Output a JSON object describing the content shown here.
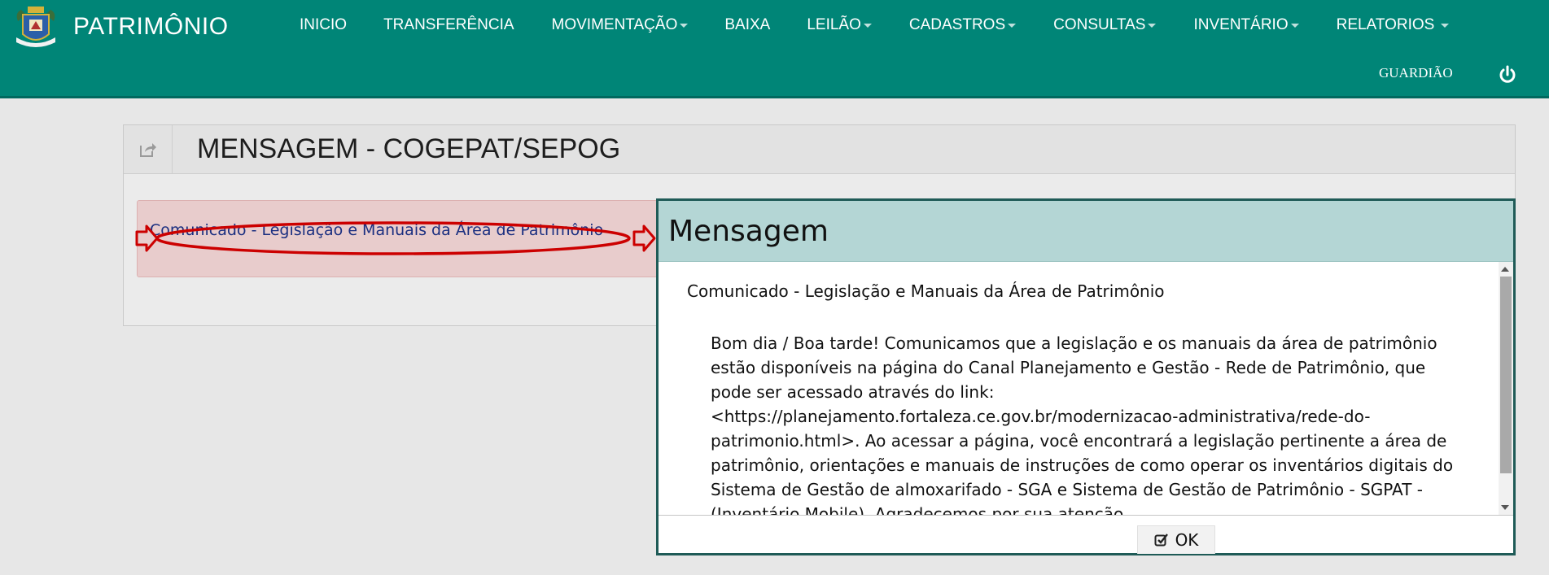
{
  "app": {
    "title": "PATRIMÔNIO",
    "logo_icon": "city-coat-of-arms-icon",
    "user": "GUARDIÃO",
    "power_icon": "power-icon"
  },
  "menu": [
    {
      "label": "INICIO",
      "dropdown": false
    },
    {
      "label": "TRANSFERÊNCIA",
      "dropdown": false
    },
    {
      "label": "MOVIMENTAÇÃO",
      "dropdown": true
    },
    {
      "label": "BAIXA",
      "dropdown": false
    },
    {
      "label": "LEILÃO",
      "dropdown": true
    },
    {
      "label": "CADASTROS",
      "dropdown": true
    },
    {
      "label": "CONSULTAS",
      "dropdown": true
    },
    {
      "label": "INVENTÁRIO",
      "dropdown": true
    },
    {
      "label": "RELATORIOS",
      "dropdown": true
    }
  ],
  "panel": {
    "title": "MENSAGEM - COGEPAT/SEPOG",
    "icon": "share-icon",
    "link": "Comunicado - Legislação e Manuais da Área de Patrimônio"
  },
  "dialog": {
    "title": "Mensagem",
    "heading": "Comunicado - Legislação e Manuais da Área de Patrimônio",
    "body": "Bom dia / Boa tarde! Comunicamos que a legislação e os manuais da área de patrimônio estão disponíveis na página do Canal Planejamento e Gestão - Rede de Patrimônio, que pode ser acessado através do link: <https://planejamento.fortaleza.ce.gov.br/modernizacao-administrativa/rede-do-patrimonio.html>. Ao acessar a página, você encontrará a legislação pertinente a área de patrimônio, orientações e manuais de instruções de como operar os inventários digitais do Sistema de Gestão de almoxarifado - SGA e Sistema de Gestão de Patrimônio - SGPAT - (Inventário Mobile). Agradecemos por sua atenção.",
    "ok_label": "OK",
    "ok_icon": "checkbox-check-icon"
  },
  "colors": {
    "navbar": "#008577",
    "dialog_header": "#b4d6d5",
    "alert_bg": "#e8cccc",
    "annotation": "#cc0000",
    "link": "#1b2f80"
  }
}
